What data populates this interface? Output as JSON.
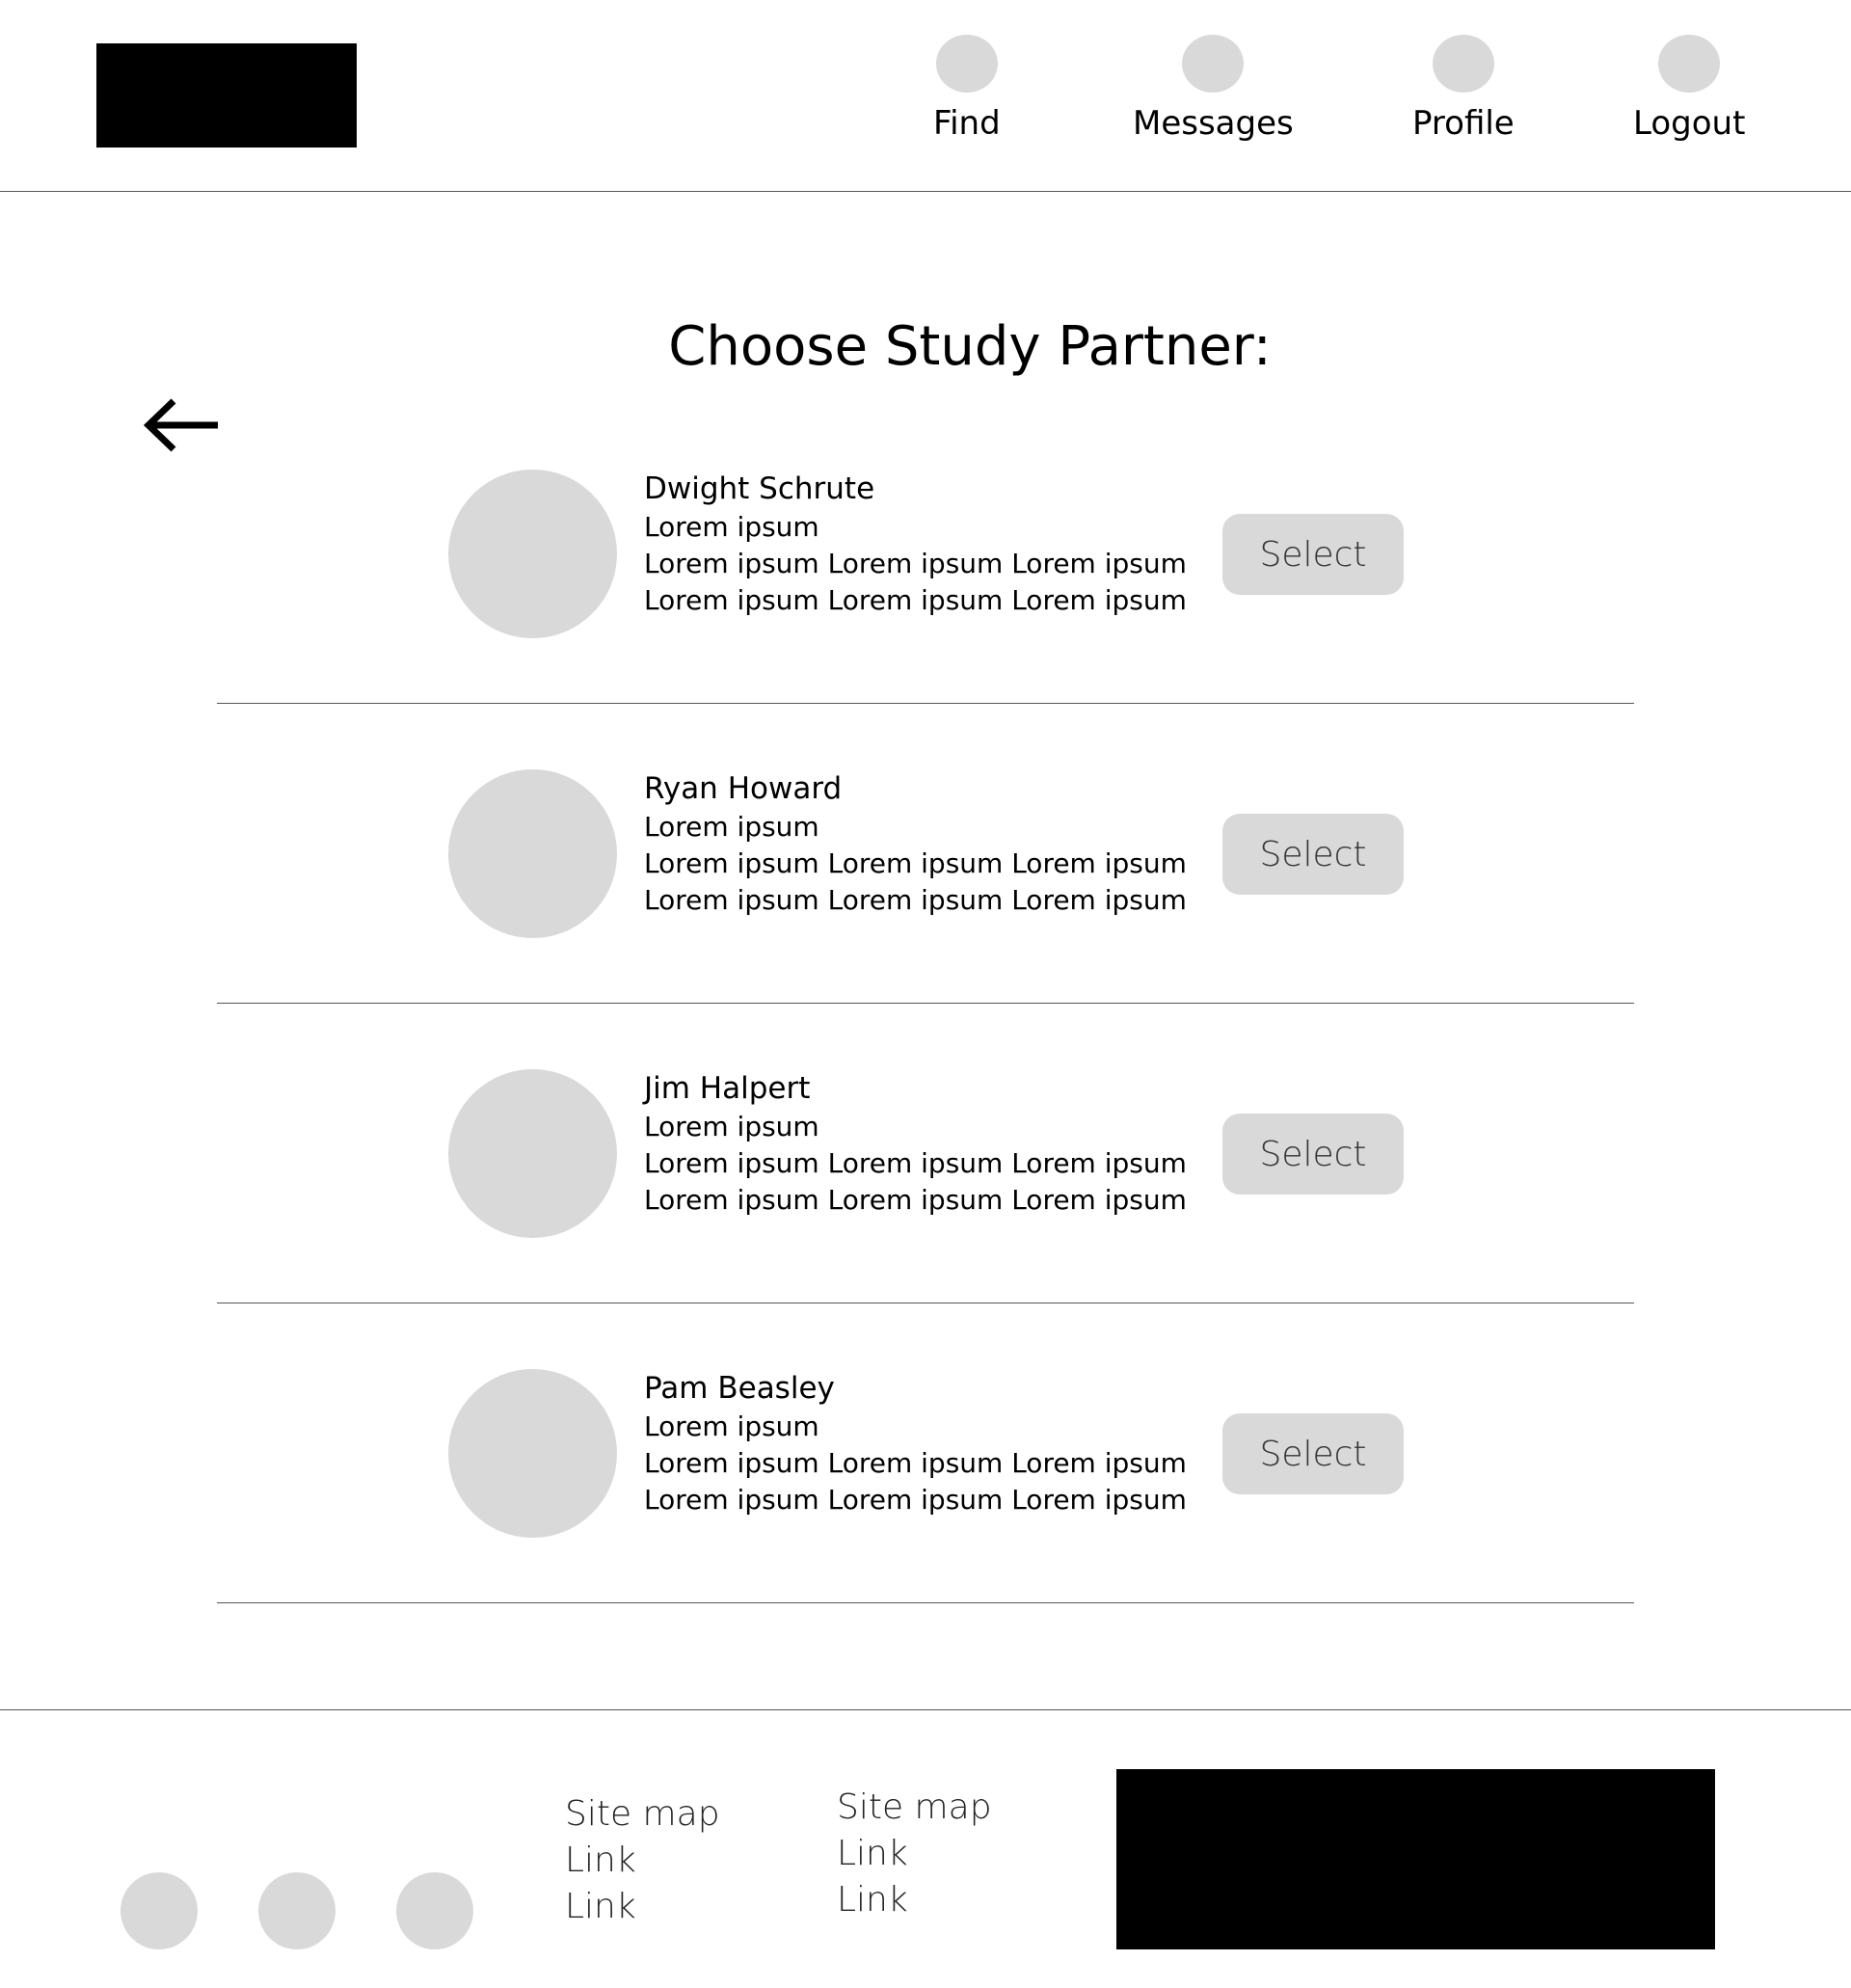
{
  "header": {
    "nav": [
      {
        "label": "Find"
      },
      {
        "label": "Messages"
      },
      {
        "label": "Profile"
      },
      {
        "label": "Logout"
      }
    ]
  },
  "main": {
    "title": "Choose Study Partner:",
    "back_icon": "arrow-left-icon",
    "partners": [
      {
        "name": "Dwight Schrute",
        "line1": "Lorem ipsum",
        "line2": "Lorem ipsum Lorem ipsum Lorem ipsum",
        "line3": "Lorem ipsum Lorem ipsum Lorem ipsum",
        "button": "Select"
      },
      {
        "name": "Ryan Howard",
        "line1": "Lorem ipsum",
        "line2": "Lorem ipsum Lorem ipsum Lorem ipsum",
        "line3": "Lorem ipsum Lorem ipsum Lorem ipsum",
        "button": "Select"
      },
      {
        "name": "Jim Halpert",
        "line1": "Lorem ipsum",
        "line2": "Lorem ipsum Lorem ipsum Lorem ipsum",
        "line3": "Lorem ipsum Lorem ipsum Lorem ipsum",
        "button": "Select"
      },
      {
        "name": "Pam Beasley",
        "line1": "Lorem ipsum",
        "line2": "Lorem ipsum Lorem ipsum Lorem ipsum",
        "line3": "Lorem ipsum Lorem ipsum Lorem ipsum",
        "button": "Select"
      }
    ]
  },
  "footer": {
    "col1": [
      "Site map",
      "Link",
      "Link"
    ],
    "col2": [
      "Site map",
      "Link",
      "Link"
    ]
  },
  "colors": {
    "placeholder_gray": "#d9d9d9",
    "block_black": "#000000",
    "rule_gray": "#555555"
  }
}
